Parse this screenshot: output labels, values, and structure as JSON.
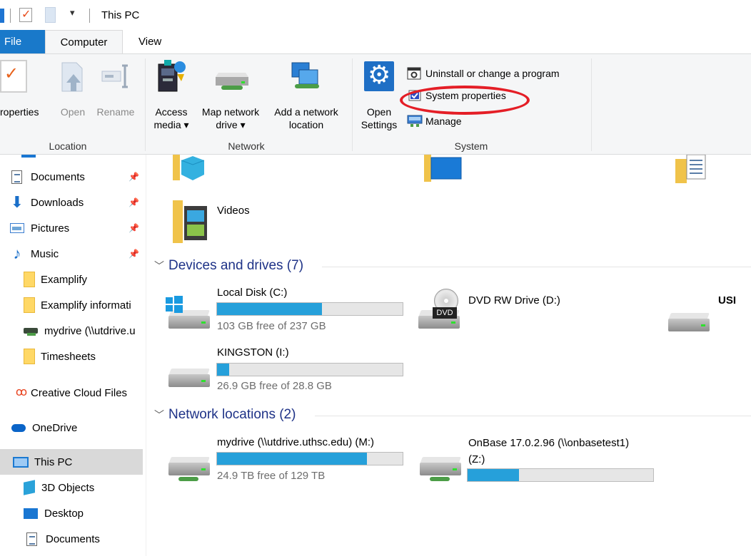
{
  "window": {
    "title": "This PC"
  },
  "quick_access": {
    "dropdown_glyph": "▾"
  },
  "tabs": [
    {
      "label": "File"
    },
    {
      "label": "Computer"
    },
    {
      "label": "View"
    }
  ],
  "ribbon": {
    "location": {
      "label": "Location",
      "properties": "roperties",
      "open": "Open",
      "rename": "Rename"
    },
    "network": {
      "label": "Network",
      "access_media_line1": "Access",
      "access_media_line2": "media ▾",
      "map_drive_line1": "Map network",
      "map_drive_line2": "drive ▾",
      "add_location_line1": "Add a network",
      "add_location_line2": "location"
    },
    "system": {
      "label": "System",
      "open_settings_line1": "Open",
      "open_settings_line2": "Settings",
      "uninstall": "Uninstall or change a program",
      "system_properties": "System properties",
      "manage": "Manage"
    }
  },
  "sidebar": {
    "items": [
      {
        "label": "Documents",
        "icon": "documents-icon",
        "pinned": true
      },
      {
        "label": "Downloads",
        "icon": "downloads-icon",
        "pinned": true
      },
      {
        "label": "Pictures",
        "icon": "pictures-icon",
        "pinned": true
      },
      {
        "label": "Music",
        "icon": "music-icon",
        "pinned": true
      },
      {
        "label": "Examplify",
        "icon": "folder-icon"
      },
      {
        "label": "Examplify informati",
        "icon": "folder-icon"
      },
      {
        "label": "mydrive (\\\\utdrive.u",
        "icon": "network-drive-icon"
      },
      {
        "label": "Timesheets",
        "icon": "folder-icon"
      },
      {
        "label": "Creative Cloud Files",
        "icon": "creative-cloud-icon"
      },
      {
        "label": "OneDrive",
        "icon": "onedrive-icon"
      },
      {
        "label": "This PC",
        "icon": "this-pc-icon",
        "selected": true
      },
      {
        "label": "3D Objects",
        "icon": "3d-objects-icon"
      },
      {
        "label": "Desktop",
        "icon": "desktop-icon"
      },
      {
        "label": "Documents",
        "icon": "documents-icon"
      }
    ],
    "pin_glyph": "📌"
  },
  "content": {
    "folders": [
      {
        "label": "Videos",
        "icon": "videos-folder-icon"
      }
    ],
    "devices_header": "Devices and drives (7)",
    "drives": [
      {
        "name": "Local Disk (C:)",
        "free": "103 GB free of 237 GB",
        "used_fraction": 0.565,
        "icon": "windows-drive-icon"
      },
      {
        "name": "DVD RW Drive (D:)",
        "icon": "dvd-drive-icon"
      },
      {
        "name": "USI",
        "icon": "usb-drive-icon"
      },
      {
        "name": "KINGSTON (I:)",
        "free": "26.9 GB free of 28.8 GB",
        "used_fraction": 0.066,
        "icon": "usb-drive-icon"
      }
    ],
    "network_header": "Network locations (2)",
    "network_drives": [
      {
        "name": "mydrive (\\\\utdrive.uthsc.edu) (M:)",
        "free": "24.9 TB free of 129 TB",
        "used_fraction": 0.807,
        "icon": "network-drive-icon"
      },
      {
        "name_line1": "OnBase 17.0.2.96 (\\\\onbasetest1)",
        "name_line2": "(Z:)",
        "used_fraction": 0.275,
        "icon": "network-drive-icon"
      }
    ],
    "dvd_badge": "DVD"
  },
  "colors": {
    "accent": "#1979ca",
    "bar_fill": "#26a0da",
    "highlight": "#e41e26",
    "section_header": "#1e3287"
  }
}
